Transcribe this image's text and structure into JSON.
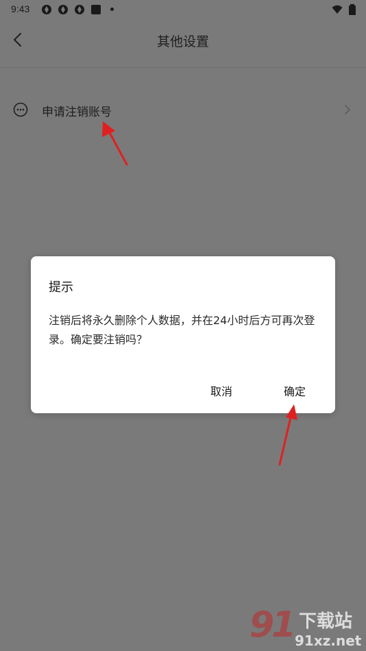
{
  "status_bar": {
    "time": "9:43",
    "icons": [
      "app-notification-icon",
      "app-notification-icon",
      "app-notification-icon",
      "square-notification-icon",
      "wifi-icon",
      "battery-icon"
    ]
  },
  "header": {
    "title": "其他设置",
    "back_icon": "chevron-left-icon"
  },
  "settings": {
    "items": [
      {
        "label": "申请注销账号",
        "icon": "more-circle-icon",
        "trailing_icon": "chevron-right-icon"
      }
    ]
  },
  "dialog": {
    "title": "提示",
    "message": "注销后将永久删除个人数据，并在24小时后方可再次登录。确定要注销吗？",
    "cancel_label": "取消",
    "confirm_label": "确定"
  },
  "watermark": {
    "logo_text": "91",
    "site_name": "下载站",
    "site_url": "91xz.net"
  },
  "colors": {
    "scrim": "#7a7a7a",
    "dialog_bg": "#ffffff",
    "annotation_arrow": "#e02020"
  }
}
